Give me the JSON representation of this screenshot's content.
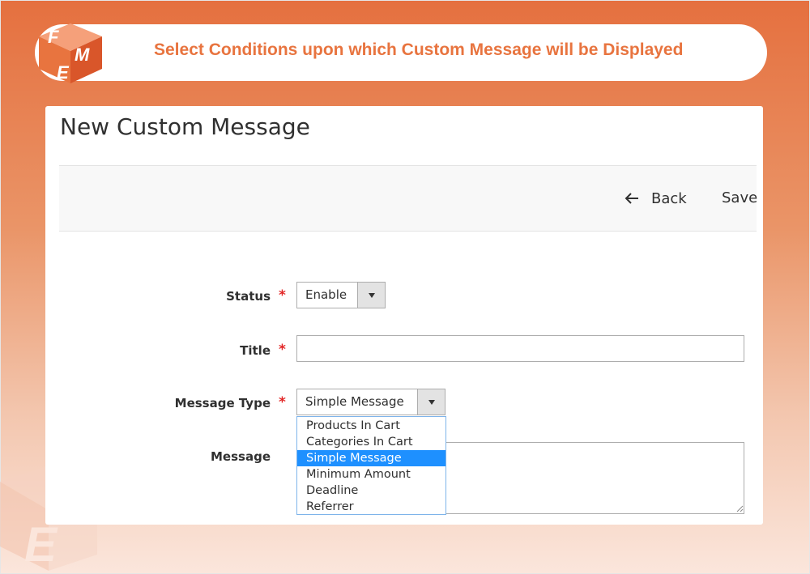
{
  "banner": {
    "title": "Select Conditions upon which Custom Message will be Displayed"
  },
  "logo": {
    "letters": [
      "F",
      "M",
      "E"
    ],
    "colors": {
      "top": "#f5a07a",
      "left": "#e8743f",
      "right": "#d9562a"
    }
  },
  "page": {
    "title": "New Custom Message"
  },
  "actions": {
    "back_label": "Back",
    "save_label": "Save"
  },
  "form": {
    "required_mark": "*",
    "status": {
      "label": "Status",
      "value": "Enable"
    },
    "title": {
      "label": "Title",
      "value": ""
    },
    "message_type": {
      "label": "Message Type",
      "value": "Simple Message",
      "options": [
        "Products In Cart",
        "Categories In Cart",
        "Simple Message",
        "Minimum Amount",
        "Deadline",
        "Referrer"
      ],
      "selected_index": 2
    },
    "message": {
      "label": "Message",
      "value": ""
    }
  },
  "colors": {
    "accent": "#e8743f",
    "required": "#e22626",
    "selected_option": "#1e90ff"
  }
}
